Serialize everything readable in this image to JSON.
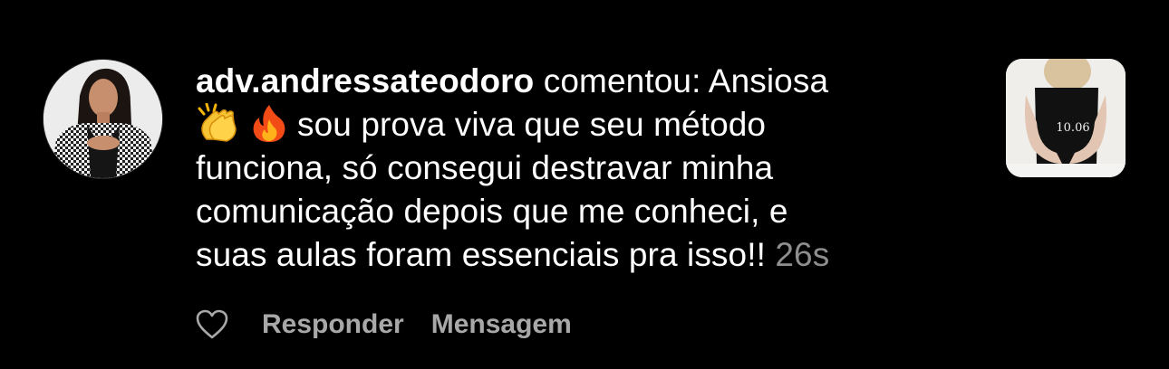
{
  "comment": {
    "username": "adv.andressateodoro",
    "verb": "comentou:",
    "line1_rest": "Ansiosa",
    "line2_text": "sou prova viva que seu método",
    "line3": "funciona, só consegui destravar minha",
    "line4": "comunicação depois que me conheci, e",
    "line5": "suas aulas foram essenciais pra isso!!",
    "timestamp": "26s",
    "emojis": [
      "clapping-hands-emoji",
      "fire-emoji"
    ]
  },
  "actions": {
    "reply_label": "Responder",
    "message_label": "Mensagem"
  },
  "thumbnail": {
    "caption": "10.06"
  },
  "colors": {
    "background": "#000000",
    "text": "#ffffff",
    "muted": "#8e8e8e",
    "action": "#a8a8a8"
  }
}
